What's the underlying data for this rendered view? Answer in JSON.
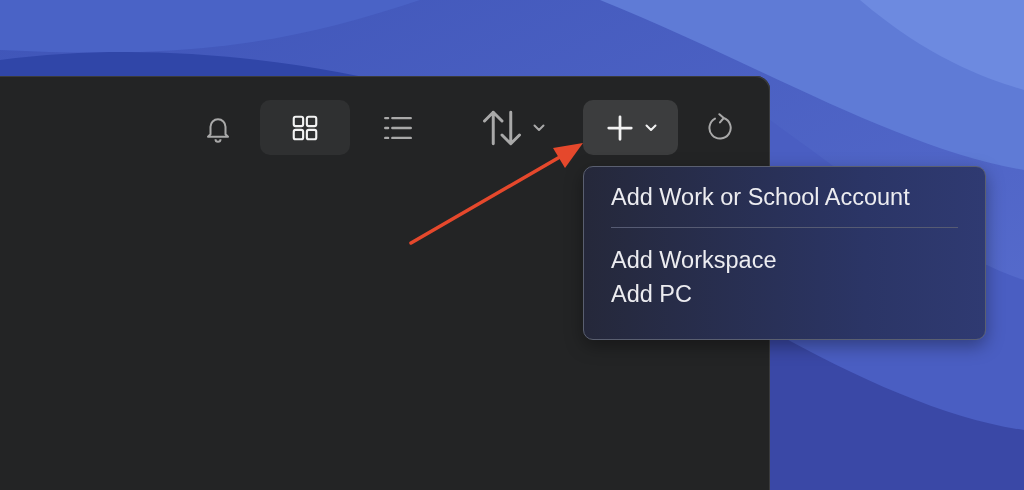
{
  "toolbar": {
    "buttons": [
      {
        "kind": "bell",
        "selected": false,
        "has_menu": false
      },
      {
        "kind": "grid",
        "selected": true,
        "has_menu": false
      },
      {
        "kind": "list",
        "selected": false,
        "has_menu": false
      },
      {
        "kind": "sort",
        "selected": false,
        "has_menu": true
      },
      {
        "kind": "add",
        "selected": true,
        "has_menu": true
      },
      {
        "kind": "refresh",
        "selected": false,
        "has_menu": false
      }
    ]
  },
  "menu": {
    "sections": [
      {
        "items": [
          {
            "label": "Add Work or School Account"
          }
        ]
      },
      {
        "items": [
          {
            "label": "Add Workspace"
          },
          {
            "label": "Add PC"
          }
        ]
      }
    ]
  }
}
